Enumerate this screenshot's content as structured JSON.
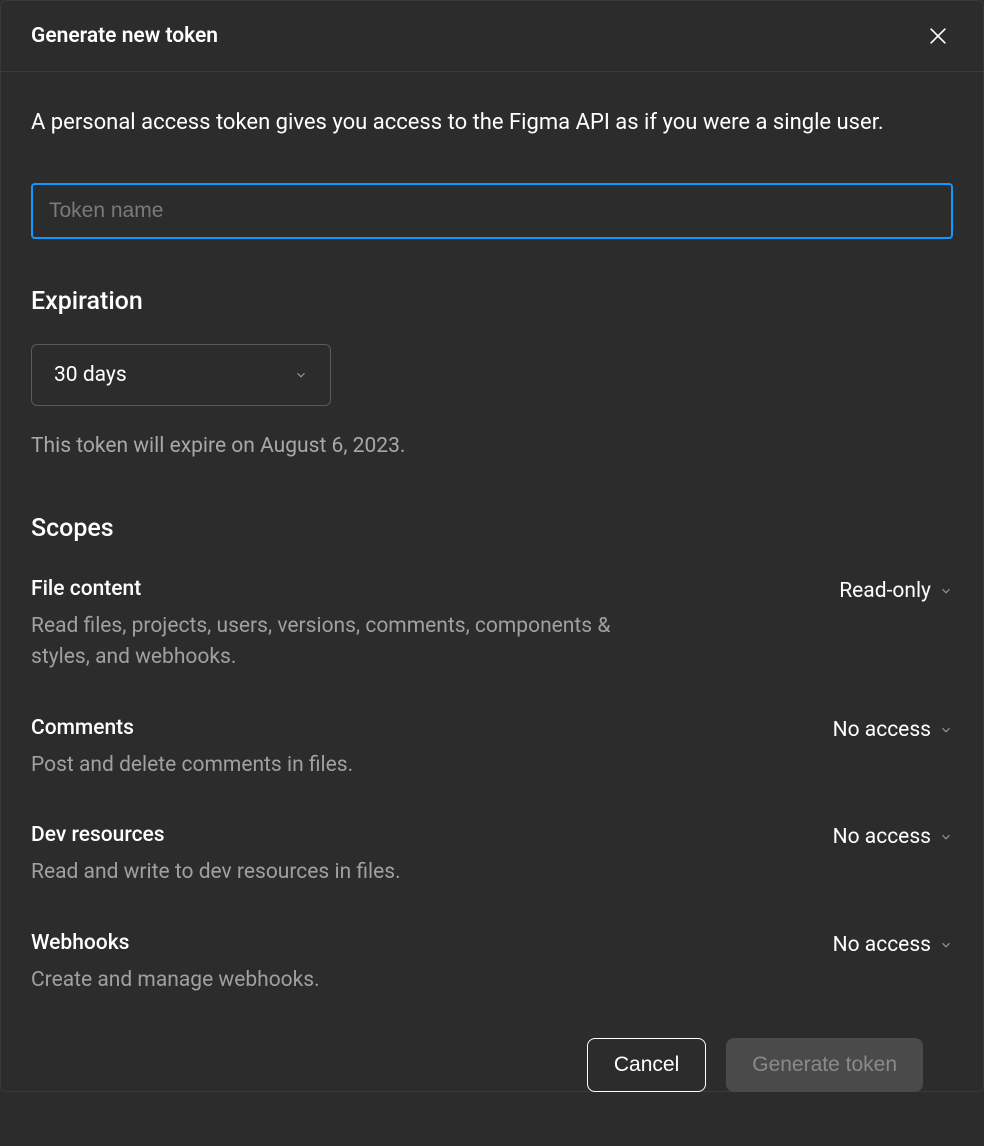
{
  "modal": {
    "title": "Generate new token",
    "description": "A personal access token gives you access to the Figma API as if you were a single user.",
    "tokenInput": {
      "placeholder": "Token name",
      "value": ""
    },
    "expiration": {
      "heading": "Expiration",
      "selected": "30 days",
      "note": "This token will expire on August 6, 2023."
    },
    "scopes": {
      "heading": "Scopes",
      "items": [
        {
          "title": "File content",
          "desc": "Read files, projects, users, versions, comments, components & styles, and webhooks.",
          "value": "Read-only"
        },
        {
          "title": "Comments",
          "desc": "Post and delete comments in files.",
          "value": "No access"
        },
        {
          "title": "Dev resources",
          "desc": "Read and write to dev resources in files.",
          "value": "No access"
        },
        {
          "title": "Webhooks",
          "desc": "Create and manage webhooks.",
          "value": "No access"
        }
      ]
    },
    "footer": {
      "cancel": "Cancel",
      "generate": "Generate token"
    }
  }
}
